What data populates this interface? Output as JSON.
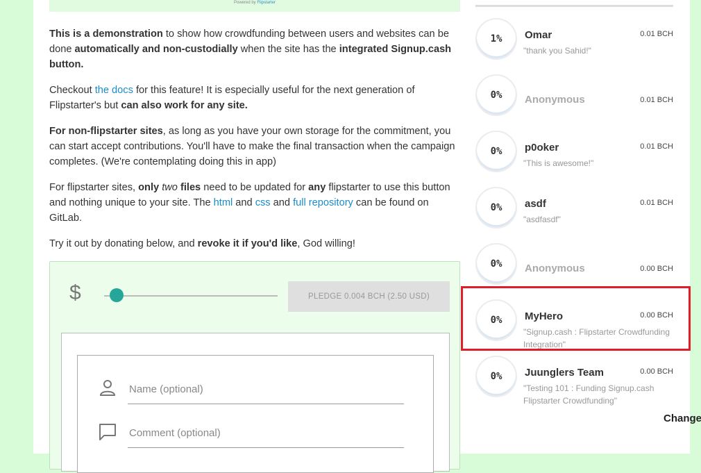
{
  "banner": {
    "powered_by": "Powered by",
    "brand": "Flipstarter"
  },
  "intro": {
    "p1": [
      {
        "t": "This is a demonstration",
        "b": true
      },
      {
        "t": " to show how crowdfunding between users and websites can be done "
      },
      {
        "t": "automatically and non-custodially",
        "b": true
      },
      {
        "t": " when the site has the "
      },
      {
        "t": "integrated Signup.cash button.",
        "b": true
      }
    ],
    "p2": [
      {
        "t": "Checkout "
      },
      {
        "t": "the docs",
        "link": true
      },
      {
        "t": " for this feature! It is especially useful for the next generation of Flipstarter's but "
      },
      {
        "t": "can also work for any site.",
        "b": true
      }
    ],
    "p3": [
      {
        "t": "For non-flipstarter sites",
        "b": true
      },
      {
        "t": ", as long as you have your own storage for the commitment, you can start accept contributions. You'll have to make the final transaction when the campaign completes. (We're contemplating doing this in app)"
      }
    ],
    "p4": [
      {
        "t": "For flipstarter sites, "
      },
      {
        "t": "only ",
        "b": true
      },
      {
        "t": "two",
        "i": true
      },
      {
        "t": " files",
        "b": true
      },
      {
        "t": " need to be updated for "
      },
      {
        "t": "any",
        "b": true
      },
      {
        "t": " flipstarter to use this button and nothing unique to your site. The "
      },
      {
        "t": "html",
        "link": true
      },
      {
        "t": " and "
      },
      {
        "t": "css",
        "link": true
      },
      {
        "t": " and "
      },
      {
        "t": "full repository",
        "link": true
      },
      {
        "t": " can be found on GitLab."
      }
    ],
    "p5": [
      {
        "t": "Try it out by donating below, and "
      },
      {
        "t": "revoke it if you'd like",
        "b": true
      },
      {
        "t": ", God willing!"
      }
    ]
  },
  "pledge": {
    "currency_symbol": "$",
    "slider_value_fraction": 0.07,
    "button_label": "PLEDGE 0.004 BCH (2.50 USD)",
    "name_placeholder": "Name (optional)",
    "comment_placeholder": "Comment (optional)",
    "accent_color": "#26a69a"
  },
  "backers": [
    {
      "percent": "1%",
      "name": "Omar",
      "amount": "0.01 BCH",
      "comment": "\"thank you Sahid!\"",
      "anonymous": false
    },
    {
      "percent": "0%",
      "name": "Anonymous",
      "amount": "0.01 BCH",
      "comment": "",
      "anonymous": true
    },
    {
      "percent": "0%",
      "name": "p0oker",
      "amount": "0.01 BCH",
      "comment": "\"This is awesome!\"",
      "anonymous": false
    },
    {
      "percent": "0%",
      "name": "asdf",
      "amount": "0.01 BCH",
      "comment": "\"asdfasdf\"",
      "anonymous": false
    },
    {
      "percent": "0%",
      "name": "Anonymous",
      "amount": "0.00 BCH",
      "comment": "",
      "anonymous": true
    },
    {
      "percent": "0%",
      "name": "MyHero",
      "amount": "0.00 BCH",
      "comment": "\"Signup.cash : Flipstarter Crowdfunding Integration\"",
      "anonymous": false
    },
    {
      "percent": "0%",
      "name": "Juunglers Team",
      "amount": "0.00 BCH",
      "comment": "\"Testing 101 : Funding Signup.cash Flipstarter Crowdfunding\"",
      "anonymous": false
    }
  ],
  "overflow_label": "Change",
  "highlight_color": "#e11d2a"
}
